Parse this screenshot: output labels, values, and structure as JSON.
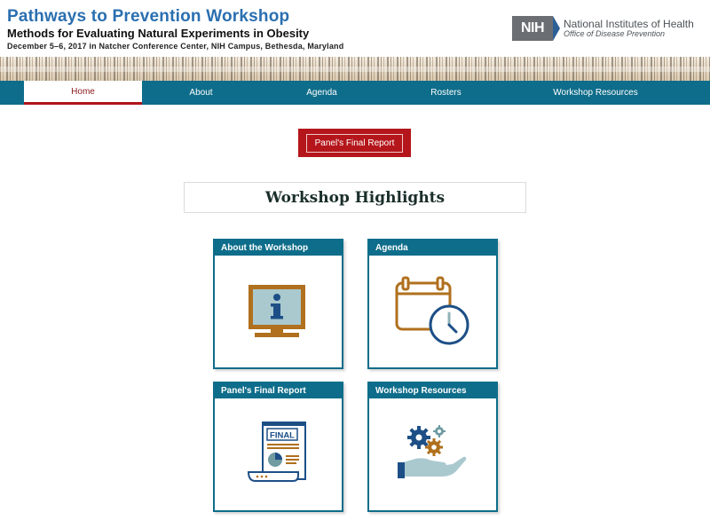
{
  "header": {
    "title": "Pathways to Prevention Workshop",
    "subtitle": "Methods for Evaluating Natural Experiments in Obesity",
    "dateline": "December 5–6, 2017 in Natcher Conference Center, NIH Campus, Bethesda, Maryland"
  },
  "nih": {
    "abbr": "NIH",
    "name": "National Institutes of Health",
    "office": "Office of Disease Prevention"
  },
  "nav": {
    "items": [
      {
        "label": "Home",
        "active": true
      },
      {
        "label": "About",
        "active": false
      },
      {
        "label": "Agenda",
        "active": false
      },
      {
        "label": "Rosters",
        "active": false
      },
      {
        "label": "Workshop Resources",
        "active": false
      }
    ]
  },
  "report_button": {
    "label": "Panel's Final Report"
  },
  "highlights": {
    "title": "Workshop Highlights"
  },
  "cards": [
    {
      "title": "About the Workshop",
      "icon": "info-monitor-icon"
    },
    {
      "title": "Agenda",
      "icon": "calendar-clock-icon"
    },
    {
      "title": "Panel's Final Report",
      "icon": "final-report-scroll-icon",
      "doc_label": "FINAL"
    },
    {
      "title": "Workshop Resources",
      "icon": "hand-gears-icon"
    }
  ],
  "colors": {
    "title_blue": "#2a6fb0",
    "nav_teal": "#0e6d8a",
    "accent_red": "#b4161b",
    "icon_brown": "#b0701e",
    "icon_blue": "#2d5f97"
  }
}
